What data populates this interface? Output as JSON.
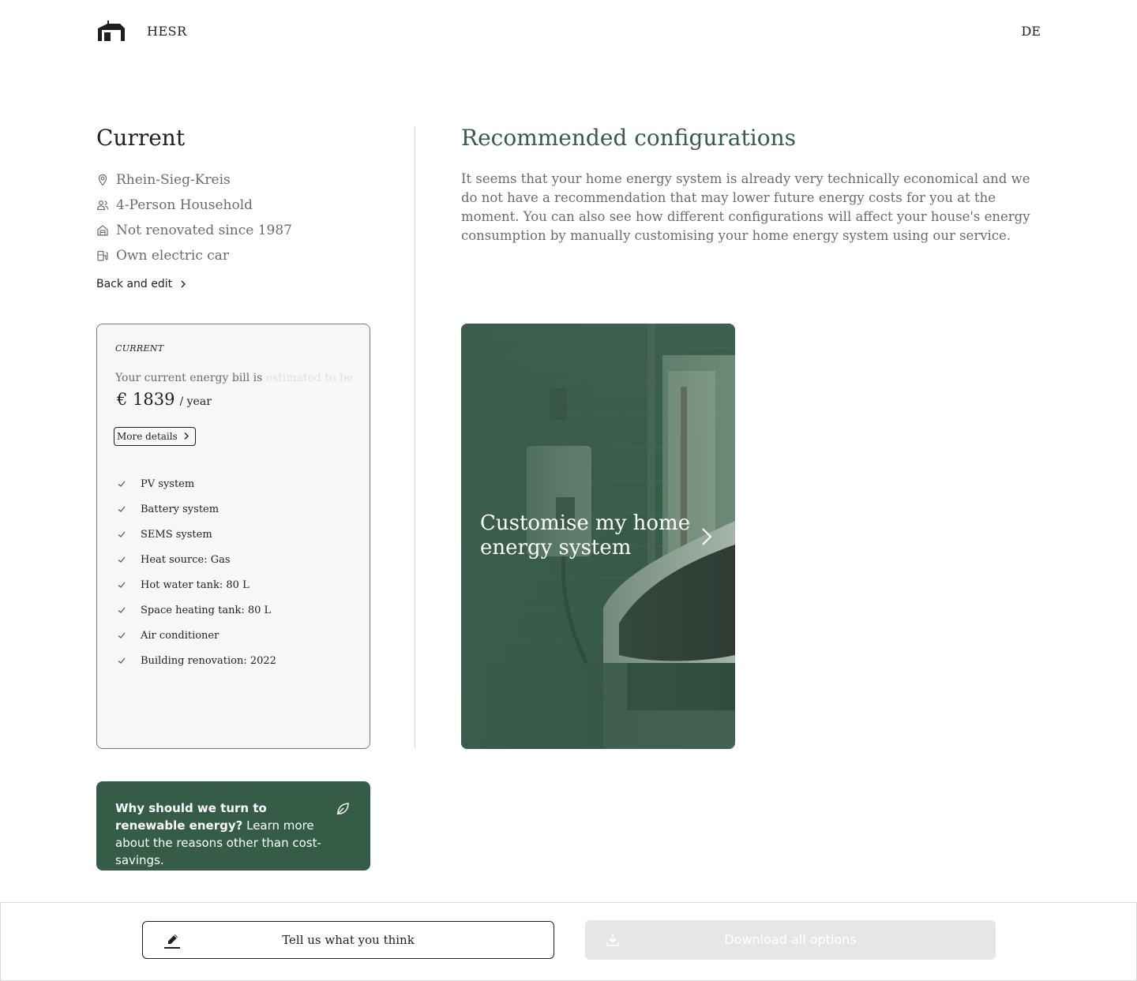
{
  "header": {
    "brand": "HESR",
    "language": "DE"
  },
  "current": {
    "title": "Current",
    "facts": [
      {
        "icon": "location-pin-icon",
        "label": "Rhein-Sieg-Kreis"
      },
      {
        "icon": "people-icon",
        "label": "4-Person Household"
      },
      {
        "icon": "house-icon",
        "label": "Not renovated since 1987"
      },
      {
        "icon": "charging-station-icon",
        "label": "Own electric car"
      }
    ],
    "back_edit": "Back and edit"
  },
  "current_card": {
    "tag": "CURRENT",
    "bill_prefix": "Your current energy bill is",
    "bill_suffix": "estimated to be",
    "bill_amount": "€ 1839",
    "bill_unit": "/ year",
    "more_details": "More details",
    "features": [
      "PV system",
      "Battery system",
      "SEMS system",
      "Heat source: Gas",
      "Hot water tank: 80 L",
      "Space heating tank: 80 L",
      "Air conditioner",
      "Building renovation: 2022"
    ]
  },
  "renewable_card": {
    "bold": "Why should we turn to renewable energy?",
    "text": " Learn more about the reasons other than cost-savings."
  },
  "recommended": {
    "title": "Recommended configurations",
    "text": "It seems that your home energy system is already very technically economical and we do not have a recommendation that may lower future energy costs for you at the moment. You can also see how different configurations will affect your house's energy consumption by manually customising your home energy system using our service."
  },
  "customise_card": {
    "title": "Customise my home energy system"
  },
  "footer": {
    "feedback": "Tell us what you think",
    "download": "Download all options"
  },
  "colors": {
    "brand_green": "#355c47",
    "text_dark": "#1f1f1f",
    "text_muted": "#6b6b6b",
    "disabled": "#e6e6e6"
  }
}
